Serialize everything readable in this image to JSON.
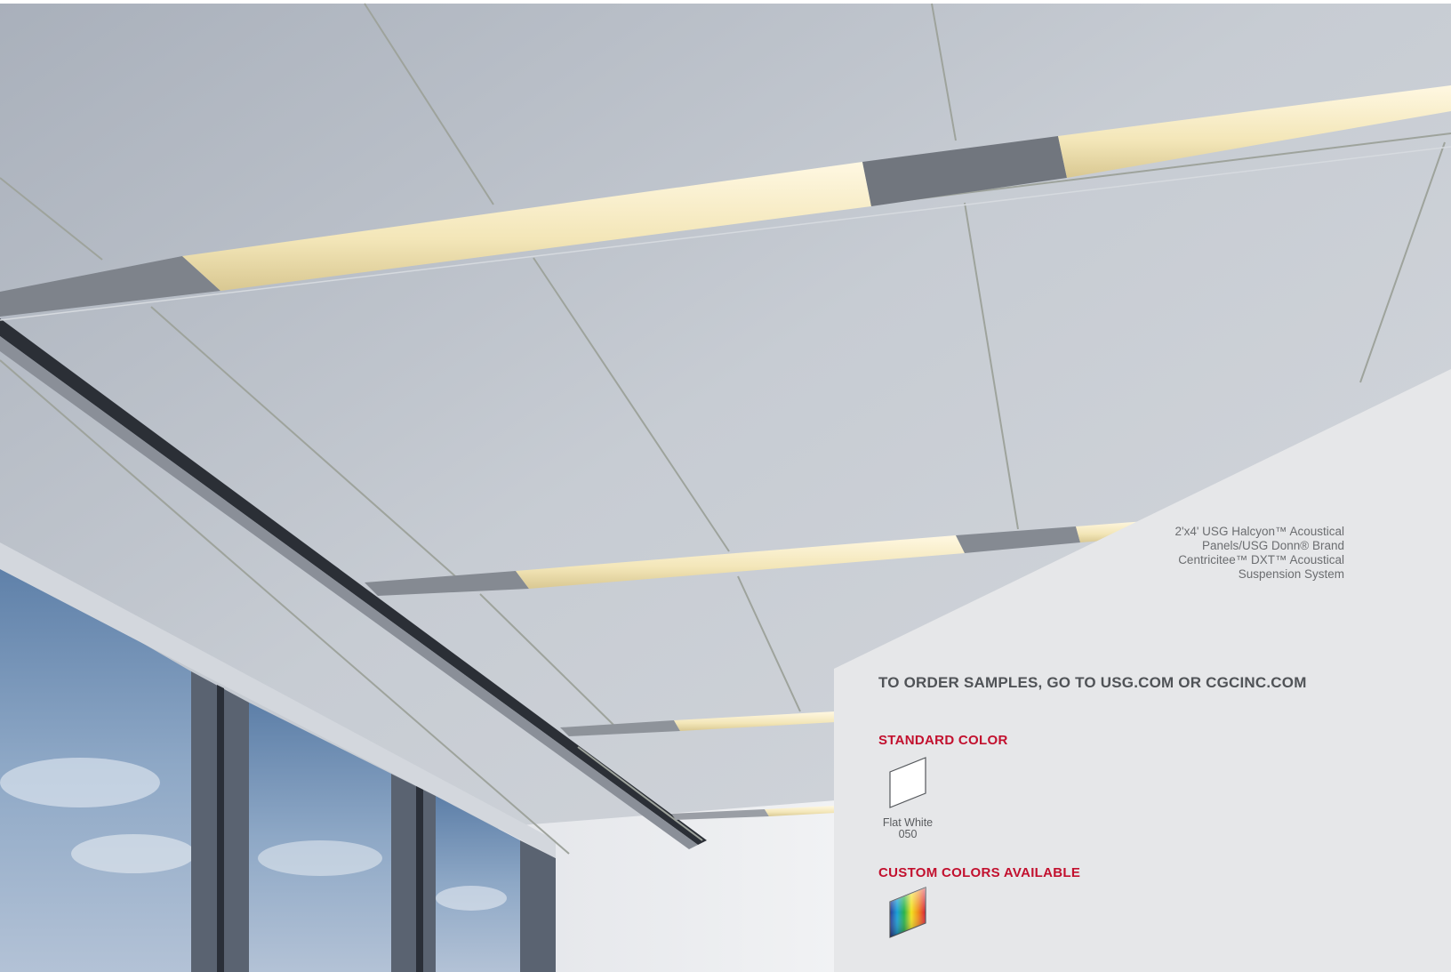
{
  "caption": {
    "lines": [
      "2'x4' USG Halcyon™ Acoustical",
      "Panels/USG Donn® Brand",
      "Centricitee™ DXT™ Acoustical",
      "Suspension System"
    ]
  },
  "order": {
    "text": "TO ORDER SAMPLES, GO TO USG.COM OR CGCINC.COM"
  },
  "standard_color": {
    "heading": "STANDARD COLOR",
    "swatch_name": "Flat White",
    "swatch_code": "050",
    "swatch_color": "#ffffff"
  },
  "custom_colors": {
    "heading": "CUSTOM COLORS AVAILABLE"
  },
  "colors": {
    "panel_background": "#e6e7e9",
    "accent_red": "#c2102e",
    "ceiling_tile": "#c9ced6",
    "light_glow": "#f4ecc8"
  }
}
